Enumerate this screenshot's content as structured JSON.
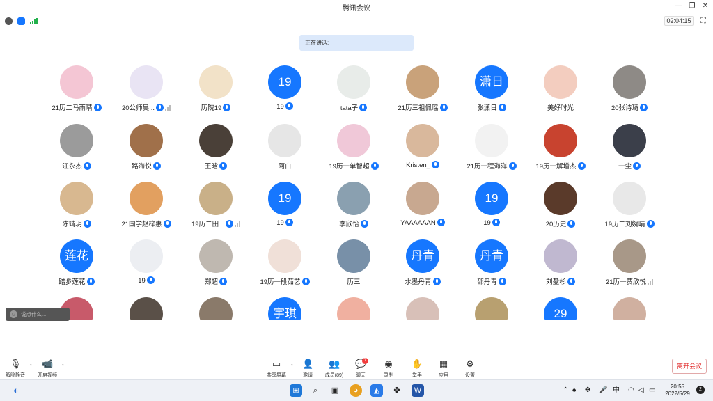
{
  "window": {
    "title": "腾讯会议"
  },
  "status": {
    "timer": "02:04:15"
  },
  "speaking": {
    "label": "正在讲话:"
  },
  "participants": [
    {
      "name": "21历二马雨晴",
      "avatar_text": "",
      "color": "#f4c6d4",
      "mic": true,
      "bars": false
    },
    {
      "name": "20公师吴...",
      "avatar_text": "",
      "color": "#e9e4f4",
      "mic": true,
      "bars": true
    },
    {
      "name": "历院19",
      "avatar_text": "",
      "color": "#f2e2c8",
      "mic": true,
      "bars": false
    },
    {
      "name": "19",
      "avatar_text": "19",
      "color": "#1677ff",
      "mic": true,
      "bars": false
    },
    {
      "name": "tata子",
      "avatar_text": "",
      "color": "#e8ece9",
      "mic": true,
      "bars": false
    },
    {
      "name": "21历三祖佩瑶",
      "avatar_text": "",
      "color": "#c9a27a",
      "mic": true,
      "bars": false
    },
    {
      "name": "张潇日",
      "avatar_text": "潇日",
      "color": "#1677ff",
      "mic": true,
      "bars": false
    },
    {
      "name": "美好时光",
      "avatar_text": "",
      "color": "#f3cdbf",
      "mic": false,
      "bars": false
    },
    {
      "name": "20张诗琦",
      "avatar_text": "",
      "color": "#8e8a86",
      "mic": true,
      "bars": false
    },
    {
      "name": "江永杰",
      "avatar_text": "",
      "color": "#9b9b9b",
      "mic": true,
      "bars": false
    },
    {
      "name": "路海悦",
      "avatar_text": "",
      "color": "#a0704a",
      "mic": true,
      "bars": false
    },
    {
      "name": "王晗",
      "avatar_text": "",
      "color": "#4a4038",
      "mic": true,
      "bars": false
    },
    {
      "name": "阿白",
      "avatar_text": "",
      "color": "#e6e6e6",
      "mic": false,
      "bars": false
    },
    {
      "name": "19历一单智超",
      "avatar_text": "",
      "color": "#f0c8d8",
      "mic": true,
      "bars": false
    },
    {
      "name": "Kristen_",
      "avatar_text": "",
      "color": "#d9b89c",
      "mic": true,
      "bars": false
    },
    {
      "name": "21历一程海洋",
      "avatar_text": "",
      "color": "#f2f2f2",
      "mic": true,
      "bars": false
    },
    {
      "name": "19历一解增杰",
      "avatar_text": "",
      "color": "#c8432f",
      "mic": true,
      "bars": false
    },
    {
      "name": "一尘",
      "avatar_text": "",
      "color": "#3b3f4a",
      "mic": true,
      "bars": false
    },
    {
      "name": "陈靖玥",
      "avatar_text": "",
      "color": "#d8b890",
      "mic": true,
      "bars": false
    },
    {
      "name": "21国学赵梓惠",
      "avatar_text": "",
      "color": "#e2a060",
      "mic": true,
      "bars": false
    },
    {
      "name": "19历二田...",
      "avatar_text": "",
      "color": "#c9b088",
      "mic": true,
      "bars": true
    },
    {
      "name": "19",
      "avatar_text": "19",
      "color": "#1677ff",
      "mic": true,
      "bars": false
    },
    {
      "name": "李欣怡",
      "avatar_text": "",
      "color": "#8aa0b0",
      "mic": true,
      "bars": false
    },
    {
      "name": "YAAAAAAN",
      "avatar_text": "",
      "color": "#c8a890",
      "mic": true,
      "bars": false
    },
    {
      "name": "19",
      "avatar_text": "19",
      "color": "#1677ff",
      "mic": true,
      "bars": false
    },
    {
      "name": "20历史",
      "avatar_text": "",
      "color": "#5a3a2a",
      "mic": true,
      "bars": false
    },
    {
      "name": "19历二刘婉晴",
      "avatar_text": "",
      "color": "#e8e8e8",
      "mic": true,
      "bars": false
    },
    {
      "name": "踏步莲花",
      "avatar_text": "莲花",
      "color": "#1677ff",
      "mic": true,
      "bars": false
    },
    {
      "name": "19",
      "avatar_text": "",
      "color": "#eceef2",
      "mic": true,
      "bars": false
    },
    {
      "name": "郑超",
      "avatar_text": "",
      "color": "#bfb8b0",
      "mic": true,
      "bars": false
    },
    {
      "name": "19历一段茹艺",
      "avatar_text": "",
      "color": "#f0e0d8",
      "mic": true,
      "bars": false
    },
    {
      "name": "历三",
      "avatar_text": "",
      "color": "#7890a8",
      "mic": false,
      "bars": false
    },
    {
      "name": "水墨丹青",
      "avatar_text": "丹青",
      "color": "#1677ff",
      "mic": true,
      "bars": false
    },
    {
      "name": "邵丹青",
      "avatar_text": "丹青",
      "color": "#1677ff",
      "mic": true,
      "bars": false
    },
    {
      "name": "刘盈杉",
      "avatar_text": "",
      "color": "#c0b8d0",
      "mic": true,
      "bars": false
    },
    {
      "name": "21历一贾欣悦",
      "avatar_text": "",
      "color": "#a89888",
      "mic": false,
      "bars": true
    },
    {
      "name": "",
      "avatar_text": "",
      "color": "#c85a6a",
      "mic": false,
      "bars": false
    },
    {
      "name": "",
      "avatar_text": "",
      "color": "#5a5048",
      "mic": false,
      "bars": false
    },
    {
      "name": "",
      "avatar_text": "",
      "color": "#8a7a6a",
      "mic": false,
      "bars": false
    },
    {
      "name": "",
      "avatar_text": "宇琪",
      "color": "#1677ff",
      "mic": false,
      "bars": false
    },
    {
      "name": "",
      "avatar_text": "",
      "color": "#f0b0a0",
      "mic": false,
      "bars": false
    },
    {
      "name": "",
      "avatar_text": "",
      "color": "#d8c0b8",
      "mic": false,
      "bars": false
    },
    {
      "name": "",
      "avatar_text": "",
      "color": "#b8a070",
      "mic": false,
      "bars": false
    },
    {
      "name": "",
      "avatar_text": "29",
      "color": "#1677ff",
      "mic": false,
      "bars": false
    },
    {
      "name": "",
      "avatar_text": "",
      "color": "#d0b0a0",
      "mic": false,
      "bars": false
    }
  ],
  "chat": {
    "placeholder": "说点什么..."
  },
  "toolbar": {
    "mute": "解除静音",
    "video": "开启视频",
    "share": "共享屏幕",
    "invite": "邀请",
    "members": "成员(89)",
    "chat": "聊天",
    "chat_badge": "7",
    "record": "录制",
    "raise_hand": "举手",
    "apps": "应用",
    "settings": "设置",
    "leave": "离开会议"
  },
  "taskbar": {
    "ime": "中",
    "time": "20:55",
    "date": "2022/5/29",
    "notifications": "2"
  },
  "colors": {
    "accent": "#1677ff",
    "danger": "#e02020"
  }
}
